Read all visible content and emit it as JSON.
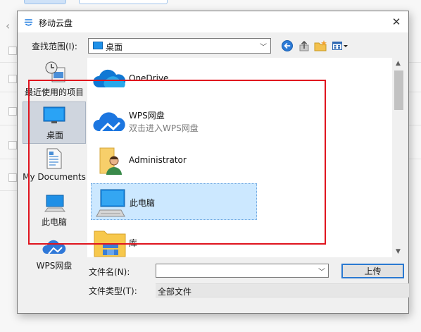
{
  "dialog": {
    "title": "移动云盘",
    "close_glyph": "✕"
  },
  "lookin": {
    "label": "查找范围(I):",
    "value": "桌面"
  },
  "places": [
    {
      "label": "最近使用的项目",
      "icon": "recent-items-icon"
    },
    {
      "label": "桌面",
      "icon": "desktop-icon",
      "selected": true
    },
    {
      "label": "My Documents",
      "icon": "documents-icon"
    },
    {
      "label": "此电脑",
      "icon": "computer-icon"
    },
    {
      "label": "WPS网盘",
      "icon": "wps-cloud-icon"
    }
  ],
  "files": [
    {
      "name": "OneDrive",
      "icon": "onedrive-cloud-icon"
    },
    {
      "name": "WPS网盘",
      "subtitle": "双击进入WPS网盘",
      "icon": "wps-cloud-icon"
    },
    {
      "name": "Administrator",
      "icon": "user-folder-icon"
    },
    {
      "name": "此电脑",
      "icon": "computer-icon",
      "selected": true
    },
    {
      "name": "库",
      "icon": "library-folder-icon"
    }
  ],
  "filename": {
    "label": "文件名(N):",
    "value": ""
  },
  "filetype": {
    "label": "文件类型(T):",
    "value": "全部文件"
  },
  "buttons": {
    "upload": "上传"
  },
  "colors": {
    "accent": "#2a79d1",
    "selection": "#cce8ff",
    "annotation": "#e0141e"
  }
}
